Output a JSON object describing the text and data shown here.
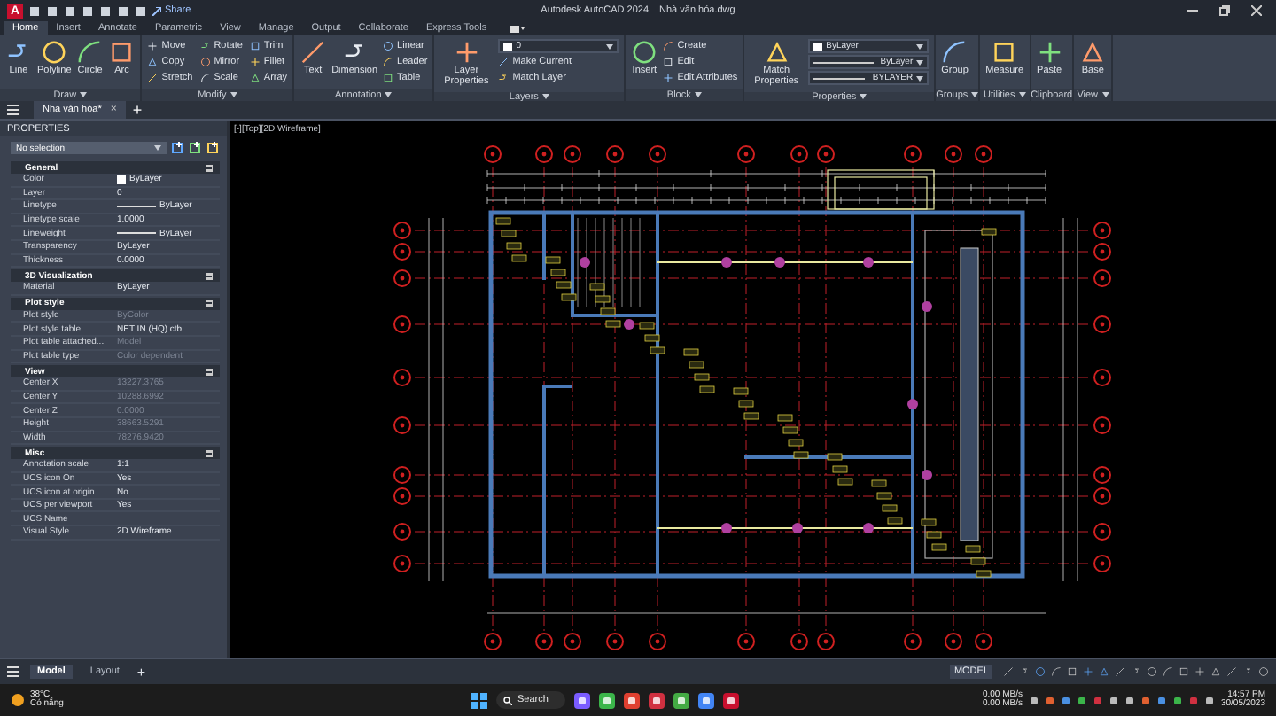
{
  "window": {
    "logo": "A",
    "share": "Share",
    "title": "Autodesk AutoCAD 2024",
    "file": "Nhà văn hóa.dwg"
  },
  "ribbon": {
    "tabs": [
      {
        "label": "Home",
        "selected": true
      },
      {
        "label": "Insert",
        "selected": false
      },
      {
        "label": "Annotate",
        "selected": false
      },
      {
        "label": "Parametric",
        "selected": false
      },
      {
        "label": "View",
        "selected": false
      },
      {
        "label": "Manage",
        "selected": false
      },
      {
        "label": "Output",
        "selected": false
      },
      {
        "label": "Collaborate",
        "selected": false
      },
      {
        "label": "Express Tools",
        "selected": false
      }
    ],
    "panels": [
      {
        "title": "Draw",
        "menu": true,
        "tools": [
          {
            "label": "Line",
            "kind": "large"
          },
          {
            "label": "Polyline",
            "kind": "large"
          },
          {
            "label": "Circle",
            "kind": "large"
          },
          {
            "label": "Arc",
            "kind": "large"
          }
        ]
      },
      {
        "title": "Modify",
        "menu": true,
        "tools": [
          {
            "label": "Move",
            "kind": "small"
          },
          {
            "label": "Copy",
            "kind": "small"
          },
          {
            "label": "Stretch",
            "kind": "small"
          },
          {
            "label": "Rotate",
            "kind": "small"
          },
          {
            "label": "Mirror",
            "kind": "small"
          },
          {
            "label": "Scale",
            "kind": "small"
          },
          {
            "label": "Trim",
            "kind": "small"
          },
          {
            "label": "Fillet",
            "kind": "small"
          },
          {
            "label": "Array",
            "kind": "small"
          }
        ]
      },
      {
        "title": "Annotation",
        "menu": true,
        "tools": [
          {
            "label": "Text",
            "kind": "large"
          },
          {
            "label": "Dimension",
            "kind": "large"
          },
          {
            "label": "Linear",
            "kind": "small"
          },
          {
            "label": "Leader",
            "kind": "small"
          },
          {
            "label": "Table",
            "kind": "small"
          }
        ]
      },
      {
        "title": "Layers",
        "menu": true,
        "tools": [
          {
            "label": "Layer Properties",
            "kind": "large"
          },
          {
            "value": "0",
            "kind": "dropdown"
          },
          {
            "label": "Make Current",
            "kind": "small"
          },
          {
            "label": "Match Layer",
            "kind": "small"
          }
        ]
      },
      {
        "title": "Block",
        "menu": true,
        "tools": [
          {
            "label": "Insert",
            "kind": "large"
          },
          {
            "label": "Create",
            "kind": "small"
          },
          {
            "label": "Edit",
            "kind": "small"
          },
          {
            "label": "Edit Attributes",
            "kind": "small"
          }
        ]
      },
      {
        "title": "Properties",
        "menu": true,
        "tools": [
          {
            "label": "Match Properties",
            "kind": "large"
          },
          {
            "value": "ByLayer",
            "kind": "dropdown"
          },
          {
            "value": "ByLayer",
            "kind": "line-dropdown"
          },
          {
            "value": "BYLAYER",
            "kind": "line-dropdown"
          }
        ]
      },
      {
        "title": "Groups",
        "menu": true,
        "tools": [
          {
            "label": "Group",
            "kind": "large"
          }
        ]
      },
      {
        "title": "Utilities",
        "menu": true,
        "tools": [
          {
            "label": "Measure",
            "kind": "large"
          }
        ]
      },
      {
        "title": "Clipboard",
        "menu": false,
        "tools": [
          {
            "label": "Paste",
            "kind": "large"
          }
        ]
      },
      {
        "title": "View",
        "menu": true,
        "tools": [
          {
            "label": "Base",
            "kind": "large"
          }
        ]
      }
    ]
  },
  "file_tabs": {
    "tabs": [
      {
        "label": "Nhà văn hóa*",
        "selected": true,
        "close": "×"
      }
    ],
    "new_tab": "+"
  },
  "properties": {
    "title": "PROPERTIES",
    "selection": "No selection",
    "sections": [
      {
        "title": "General",
        "expanded": true,
        "rows": [
          {
            "label": "Color",
            "value": "ByLayer",
            "kind": "color",
            "disabled": false
          },
          {
            "label": "Layer",
            "value": "0",
            "kind": "text",
            "disabled": false
          },
          {
            "label": "Linetype",
            "value": "ByLayer",
            "kind": "line",
            "disabled": false
          },
          {
            "label": "Linetype scale",
            "value": "1.0000",
            "kind": "text",
            "disabled": false
          },
          {
            "label": "Lineweight",
            "value": "ByLayer",
            "kind": "line",
            "disabled": false
          },
          {
            "label": "Transparency",
            "value": "ByLayer",
            "kind": "text",
            "disabled": false
          },
          {
            "label": "Thickness",
            "value": "0.0000",
            "kind": "text",
            "disabled": false
          }
        ]
      },
      {
        "title": "3D Visualization",
        "expanded": true,
        "rows": [
          {
            "label": "Material",
            "value": "ByLayer",
            "kind": "text",
            "disabled": false
          }
        ]
      },
      {
        "title": "Plot style",
        "expanded": true,
        "rows": [
          {
            "label": "Plot style",
            "value": "ByColor",
            "kind": "text",
            "disabled": true
          },
          {
            "label": "Plot style table",
            "value": "NET IN (HQ).ctb",
            "kind": "text",
            "disabled": false
          },
          {
            "label": "Plot table attached...",
            "value": "Model",
            "kind": "text",
            "disabled": true
          },
          {
            "label": "Plot table type",
            "value": "Color dependent",
            "kind": "text",
            "disabled": true
          }
        ]
      },
      {
        "title": "View",
        "expanded": true,
        "rows": [
          {
            "label": "Center X",
            "value": "13227.3765",
            "kind": "text",
            "disabled": true
          },
          {
            "label": "Center Y",
            "value": "10288.6992",
            "kind": "text",
            "disabled": true
          },
          {
            "label": "Center Z",
            "value": "0.0000",
            "kind": "text",
            "disabled": true
          },
          {
            "label": "Height",
            "value": "38663.5291",
            "kind": "text",
            "disabled": true
          },
          {
            "label": "Width",
            "value": "78276.9420",
            "kind": "text",
            "disabled": true
          }
        ]
      },
      {
        "title": "Misc",
        "expanded": true,
        "rows": [
          {
            "label": "Annotation scale",
            "value": "1:1",
            "kind": "text",
            "disabled": false
          },
          {
            "label": "UCS icon On",
            "value": "Yes",
            "kind": "text",
            "disabled": false
          },
          {
            "label": "UCS icon at origin",
            "value": "No",
            "kind": "text",
            "disabled": false
          },
          {
            "label": "UCS per viewport",
            "value": "Yes",
            "kind": "text",
            "disabled": false
          },
          {
            "label": "UCS Name",
            "kind": "text",
            "disabled": false
          },
          {
            "label": "Visual Style",
            "value": "2D Wireframe",
            "kind": "text",
            "disabled": false
          }
        ]
      }
    ]
  },
  "viewport": {
    "label": "[-][Top][2D Wireframe]"
  },
  "status_bar": {
    "tabs": [
      {
        "label": "Model",
        "selected": true
      },
      {
        "label": "Layout",
        "selected": false
      }
    ],
    "new_tab": "+",
    "space": "MODEL"
  },
  "taskbar": {
    "temperature": "38°C",
    "weather": "Có nắng",
    "search": "Search",
    "upload": "0.00 MB/s",
    "download": "0.00 MB/s",
    "time": "14:57 PM",
    "date": "30/05/2023"
  }
}
